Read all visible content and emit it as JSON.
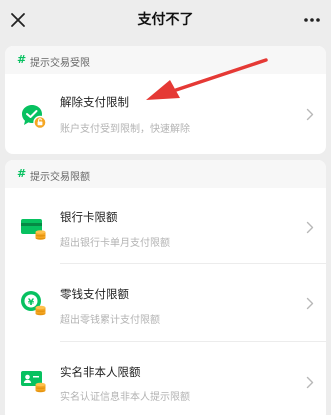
{
  "header": {
    "title": "支付不了",
    "close_icon": "close-icon",
    "more_icon": "more-icon"
  },
  "sections": [
    {
      "title": "提示交易受限",
      "hash": "#",
      "items": [
        {
          "title": "解除支付限制",
          "subtitle": "账户支付受到限制，快速解除",
          "icon": "chat-unlock-icon"
        }
      ]
    },
    {
      "title": "提示交易限额",
      "hash": "#",
      "items": [
        {
          "title": "银行卡限额",
          "subtitle": "超出银行卡单月支付限额",
          "icon": "bank-card-icon"
        },
        {
          "title": "零钱支付限额",
          "subtitle": "超出零钱累计支付限额",
          "icon": "wallet-coin-icon"
        },
        {
          "title": "实名非本人限额",
          "subtitle": "实名认证信息非本人提示限额",
          "icon": "id-card-icon"
        }
      ]
    }
  ],
  "colors": {
    "accent_green": "#07c160",
    "coin_orange": "#f5a623",
    "arrow_red": "#e53935",
    "background": "#ededed"
  }
}
